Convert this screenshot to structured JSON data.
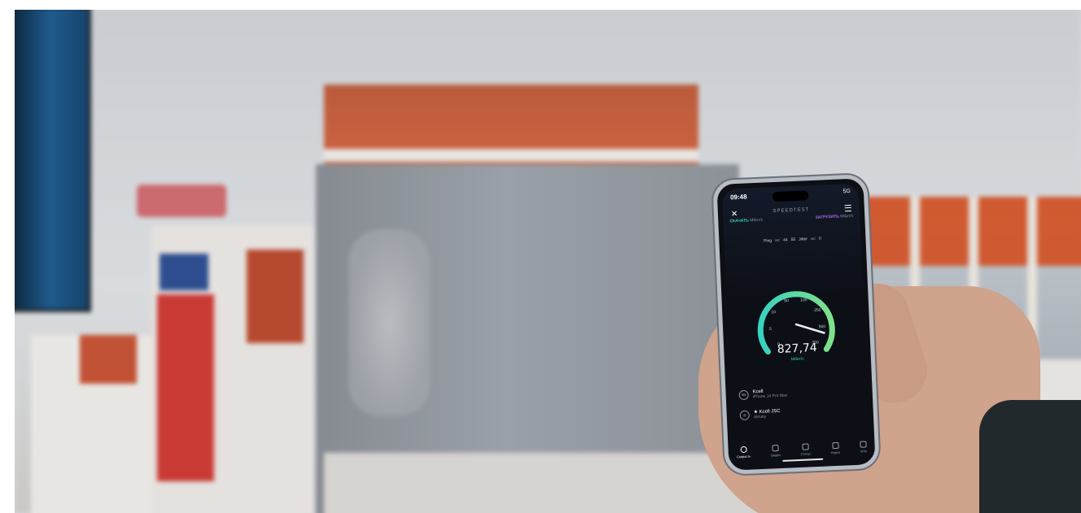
{
  "status_bar": {
    "time": "09:48",
    "network": "5G"
  },
  "app": {
    "brand": "SPEEDTEST"
  },
  "results": {
    "download_label": "СКАЧАТЬ",
    "download_unit": "Мбит/с",
    "upload_label": "ЗАГРУЗИТЬ",
    "upload_unit": "Мбит/с"
  },
  "metrics": {
    "ping_label": "Ping",
    "ping_unit": "мс",
    "ping_idle": "44",
    "ping_down": "55",
    "jitter_label": "Jitter",
    "jitter_unit": "мс",
    "jitter_value": "0"
  },
  "gauge": {
    "ticks": [
      "0",
      "5",
      "10",
      "50",
      "100",
      "250",
      "500",
      "750"
    ],
    "value": "827,74",
    "unit": "Мбит/с",
    "accent_color": "#36d3c0",
    "accent_color_end": "#7fe08a"
  },
  "providers": [
    {
      "icon": "5G",
      "name": "Kcell",
      "detail": "iPhone 14 Pro Max"
    },
    {
      "icon": "◎",
      "name": "★ Kcell JSC",
      "detail": "Almaty"
    }
  ],
  "tabs": [
    {
      "label": "Скорость",
      "icon": "speed-icon"
    },
    {
      "label": "Видео",
      "icon": "play-icon"
    },
    {
      "label": "Статус",
      "icon": "status-icon"
    },
    {
      "label": "Карта",
      "icon": "map-icon"
    },
    {
      "label": "VPN",
      "icon": "vpn-icon"
    }
  ]
}
